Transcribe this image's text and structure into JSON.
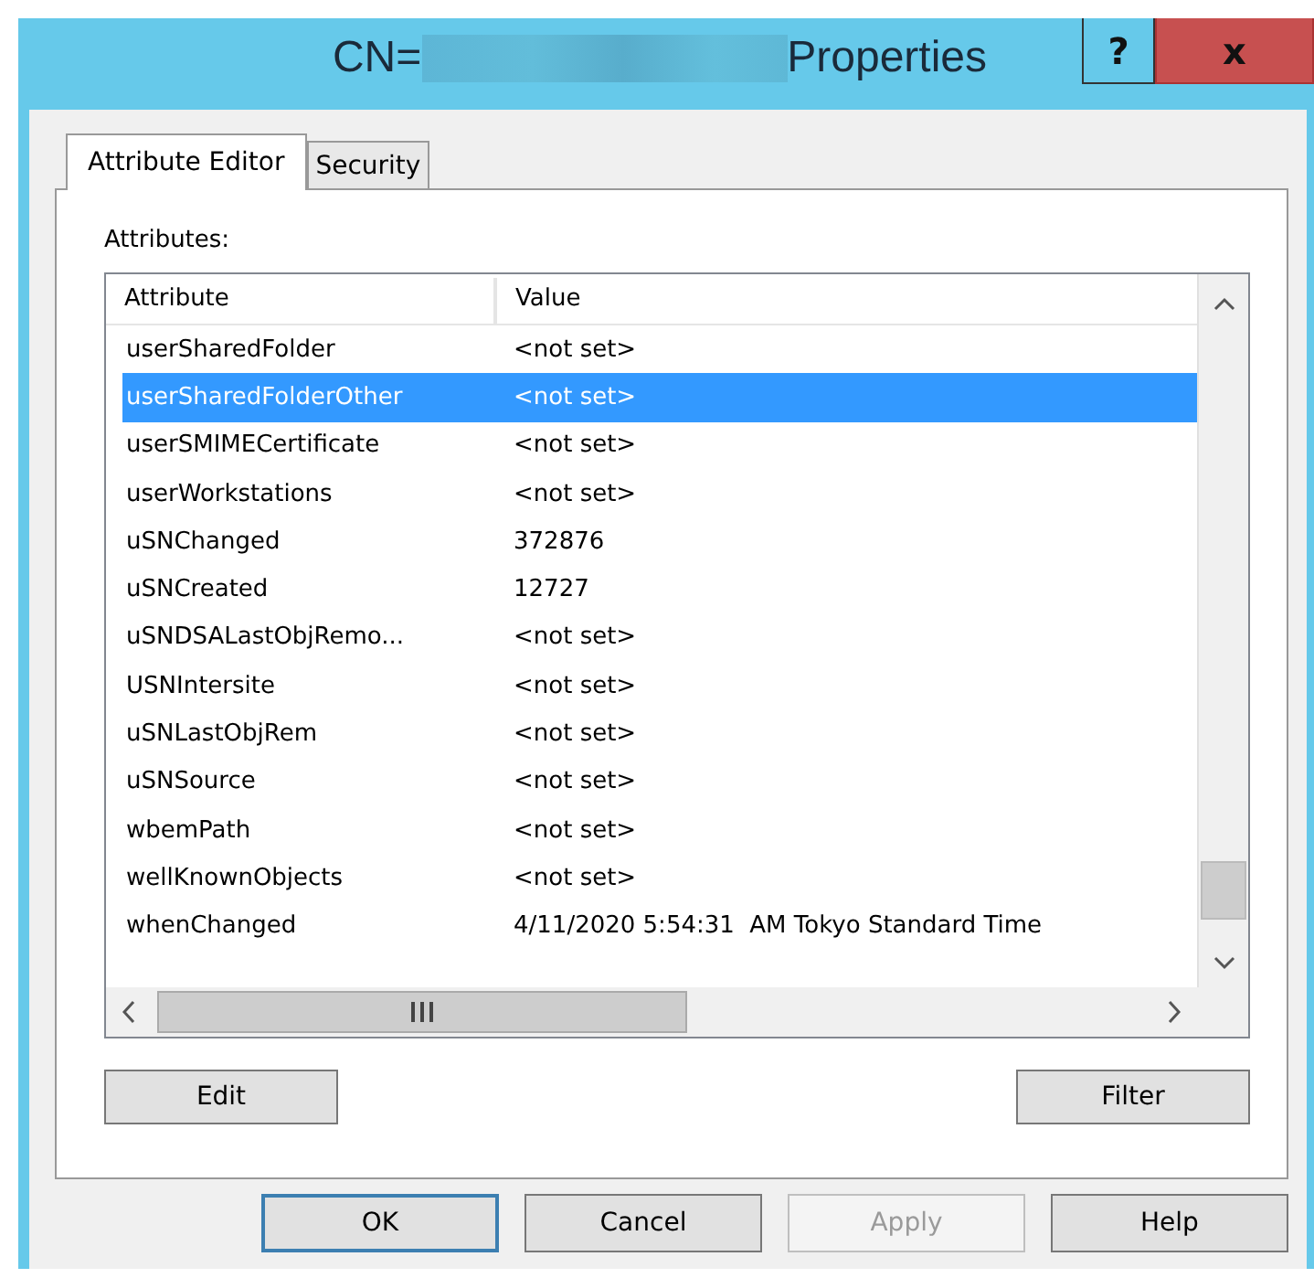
{
  "window": {
    "title_prefix": "CN=",
    "title_suffix": "Properties",
    "help_button": "?",
    "close_button": "x"
  },
  "tabs": [
    {
      "label": "Attribute Editor",
      "selected": true
    },
    {
      "label": "Security",
      "selected": false
    }
  ],
  "attributes_label": "Attributes:",
  "table": {
    "columns": [
      "Attribute",
      "Value"
    ],
    "rows": [
      {
        "attribute": "userSharedFolder",
        "value": "<not set>",
        "selected": false
      },
      {
        "attribute": "userSharedFolderOther",
        "value": "<not set>",
        "selected": true
      },
      {
        "attribute": "userSMIMECertificate",
        "value": "<not set>",
        "selected": false
      },
      {
        "attribute": "userWorkstations",
        "value": "<not set>",
        "selected": false
      },
      {
        "attribute": "uSNChanged",
        "value": "372876",
        "selected": false
      },
      {
        "attribute": "uSNCreated",
        "value": "12727",
        "selected": false
      },
      {
        "attribute": "uSNDSALastObjRemo...",
        "value": "<not set>",
        "selected": false
      },
      {
        "attribute": "USNIntersite",
        "value": "<not set>",
        "selected": false
      },
      {
        "attribute": "uSNLastObjRem",
        "value": "<not set>",
        "selected": false
      },
      {
        "attribute": "uSNSource",
        "value": "<not set>",
        "selected": false
      },
      {
        "attribute": "wbemPath",
        "value": "<not set>",
        "selected": false
      },
      {
        "attribute": "wellKnownObjects",
        "value": "<not set>",
        "selected": false
      },
      {
        "attribute": "whenChanged",
        "value": "4/11/2020 5:54:31  AM Tokyo Standard Time",
        "selected": false
      }
    ]
  },
  "panel_buttons": [
    {
      "label": "Edit"
    },
    {
      "label": "Filter"
    }
  ],
  "buttons": [
    {
      "label": "OK",
      "default": true,
      "disabled": false
    },
    {
      "label": "Cancel",
      "default": false,
      "disabled": false
    },
    {
      "label": "Apply",
      "default": false,
      "disabled": true
    },
    {
      "label": "Help",
      "default": false,
      "disabled": false
    }
  ]
}
